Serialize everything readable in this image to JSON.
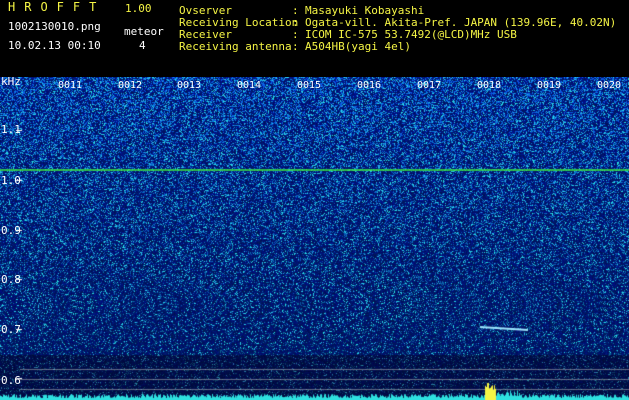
{
  "app": {
    "title": "HROFFT",
    "version": "1.00",
    "file_name": "1002130010.png",
    "date_time": "10.02.13 00:10",
    "meteor_label": "meteor",
    "meteor_count": "4"
  },
  "info": [
    {
      "key": "Ovserver",
      "sep": ":",
      "value": "Masayuki Kobayashi"
    },
    {
      "key": "Receiving Location",
      "sep": ":",
      "value": "Ogata-vill. Akita-Pref. JAPAN (139.96E, 40.02N)"
    },
    {
      "key": "Receiver",
      "sep": ":",
      "value": "ICOM IC-575 53.7492(@LCD)MHz USB"
    },
    {
      "key": "Receiving antenna",
      "sep": ":",
      "value": "A504HB(yagi 4el)"
    }
  ],
  "spectrogram": {
    "freq_unit": "kHz",
    "freq_ticks": [
      "1.1",
      "1.0",
      "0.9",
      "0.8",
      "0.7",
      "0.6"
    ],
    "time_ticks": [
      "0011",
      "0012",
      "0013",
      "0014",
      "0015",
      "0016",
      "0017",
      "0018",
      "0019",
      "0020"
    ],
    "carrier_khz": 1.02,
    "meteor_echo_khz": 0.7,
    "colors": {
      "background": "#000000",
      "signal_strong": "#f5f545",
      "carrier": "#3ef03e",
      "noise": "#1428b4"
    }
  }
}
